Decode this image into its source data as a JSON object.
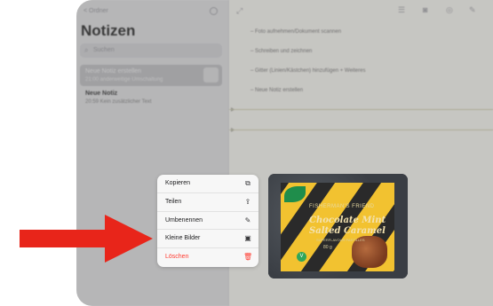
{
  "sidebar": {
    "back_label": "< Ordner",
    "title": "Notizen",
    "search_placeholder": "Suchen",
    "notes": [
      {
        "title": "Neue Notiz erstellen",
        "subtitle": "21:00 anderweitige Umschaltung"
      },
      {
        "title": "Neue Notiz",
        "subtitle": "20:59 Kein zusätzlicher Text"
      }
    ]
  },
  "note_content": {
    "lines": [
      "–  Foto aufnehmen/Dokument scannen",
      "–  Schreiben und zeichnen",
      "–  Gitter (Linien/Kästchen) hinzufügen + Weiteres",
      "–  Neue Notiz erstellen"
    ]
  },
  "context_menu": {
    "items": [
      {
        "label": "Kopieren",
        "icon": "copy-icon",
        "glyph": "⧉"
      },
      {
        "label": "Teilen",
        "icon": "share-icon",
        "glyph": "⇪"
      },
      {
        "label": "Umbenennen",
        "icon": "rename-icon",
        "glyph": "✎"
      },
      {
        "label": "Kleine Bilder",
        "icon": "image-icon",
        "glyph": "▣"
      },
      {
        "label": "Löschen",
        "icon": "trash-icon",
        "glyph": "🗑",
        "destructive": true
      }
    ]
  },
  "preview": {
    "brand": "FISHERMAN'S FRIEND",
    "line1": "Chocolate Mint",
    "line2": "Salted Caramel",
    "sub": "SUPERFLAVOUR PASTILLES",
    "weight": "80 g"
  },
  "colors": {
    "arrow": "#e8251a",
    "destructive": "#ff3b30"
  }
}
